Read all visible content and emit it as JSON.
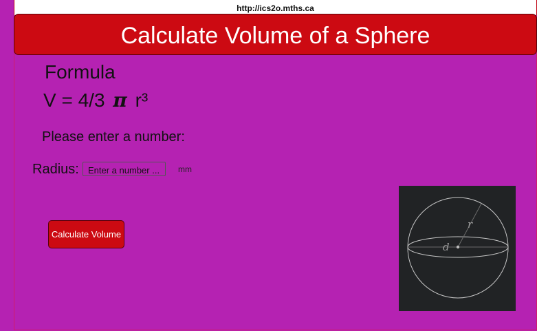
{
  "browser": {
    "url": "http://ics2o.mths.ca"
  },
  "header": {
    "title": "Calculate Volume of a Sphere"
  },
  "formula": {
    "label": "Formula",
    "prefix": "V = 4/3 ",
    "pi_symbol": "π",
    "suffix": " r³"
  },
  "form": {
    "prompt": "Please enter a number:",
    "radius_label": "Radius:",
    "radius_placeholder": "Enter a number ...",
    "radius_value": "",
    "unit": "mm",
    "submit_label": "Calculate Volume"
  },
  "diagram": {
    "radius_label": "r",
    "diameter_label": "d"
  },
  "colors": {
    "background": "#b522b2",
    "accent": "#cc0a12",
    "diagram_bg": "#212325"
  }
}
